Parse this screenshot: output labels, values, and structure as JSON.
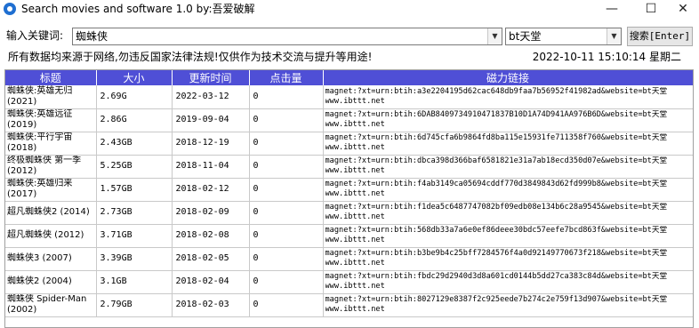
{
  "window": {
    "title": "Search movies and software 1.0 by:吾爱破解",
    "min_glyph": "—",
    "max_glyph": "☐",
    "close_glyph": "✕"
  },
  "search": {
    "label": "输入关键词:",
    "keyword": "蜘蛛侠",
    "site": "bt天堂",
    "button_label": "搜索[Enter]"
  },
  "notice": {
    "text": "所有数据均来源于网络,勿违反国家法律法规!仅供作为技术交流与提升等用途!",
    "datetime": "2022-10-11  15:10:14  星期二"
  },
  "table": {
    "headers": [
      "标题",
      "大小",
      "更新时间",
      "点击量",
      "磁力链接"
    ],
    "rows": [
      {
        "title": "蜘蛛侠:英雄无归\n(2021)",
        "size": "2.69G",
        "date": "2022-03-12",
        "clicks": "0",
        "magnet": "magnet:?xt=urn:btih:a3e2204195d62cac648db9faa7b56952f41982ad&website=bt天堂",
        "site": "www.ibttt.net"
      },
      {
        "title": "蜘蛛侠:英雄远征\n(2019)",
        "size": "2.86G",
        "date": "2019-09-04",
        "clicks": "0",
        "magnet": "magnet:?xt=urn:btih:6DAB8409734910471837B10D1A74D941AA976B6D&website=bt天堂",
        "site": "www.ibttt.net"
      },
      {
        "title": "蜘蛛侠:平行宇宙\n(2018)",
        "size": "2.43GB",
        "date": "2018-12-19",
        "clicks": "0",
        "magnet": "magnet:?xt=urn:btih:6d745cfa6b9864fd8ba115e15931fe711358f760&website=bt天堂",
        "site": "www.ibttt.net"
      },
      {
        "title": "终极蜘蛛侠 第一季\n(2012)",
        "size": "5.25GB",
        "date": "2018-11-04",
        "clicks": "0",
        "magnet": "magnet:?xt=urn:btih:dbca398d366baf6581821e31a7ab18ecd350d07e&website=bt天堂",
        "site": "www.ibttt.net"
      },
      {
        "title": "蜘蛛侠:英雄归来\n(2017)",
        "size": "1.57GB",
        "date": "2018-02-12",
        "clicks": "0",
        "magnet": "magnet:?xt=urn:btih:f4ab3149ca05694cddf770d3849843d62fd999b8&website=bt天堂",
        "site": "www.ibttt.net"
      },
      {
        "title": "超凡蜘蛛侠2 (2014)",
        "size": "2.73GB",
        "date": "2018-02-09",
        "clicks": "0",
        "magnet": "magnet:?xt=urn:btih:f1dea5c6487747082bf09edb08e134b6c28a9545&website=bt天堂",
        "site": "www.ibttt.net"
      },
      {
        "title": "超凡蜘蛛侠 (2012)",
        "size": "3.71GB",
        "date": "2018-02-08",
        "clicks": "0",
        "magnet": "magnet:?xt=urn:btih:568db33a7a6e0ef86deee30bdc57eefe7bcd863f&website=bt天堂",
        "site": "www.ibttt.net"
      },
      {
        "title": "蜘蛛侠3 (2007)",
        "size": "3.39GB",
        "date": "2018-02-05",
        "clicks": "0",
        "magnet": "magnet:?xt=urn:btih:b3be9b4c25bff7284576f4a0d92149770673f218&website=bt天堂",
        "site": "www.ibttt.net"
      },
      {
        "title": "蜘蛛侠2 (2004)",
        "size": "3.1GB",
        "date": "2018-02-04",
        "clicks": "0",
        "magnet": "magnet:?xt=urn:btih:fbdc29d2940d3d8a601cd0144b5dd27ca383c84d&website=bt天堂",
        "site": "www.ibttt.net"
      },
      {
        "title": "蜘蛛侠 Spider-Man\n(2002)",
        "size": "2.79GB",
        "date": "2018-02-03",
        "clicks": "0",
        "magnet": "magnet:?xt=urn:btih:8027129e8387f2c925eede7b274c2e759f13d907&website=bt天堂",
        "site": "www.ibttt.net"
      }
    ]
  },
  "colors": {
    "header_bg": "#4f4fd6",
    "header_text": "#ffffff",
    "app_icon": "#1f6fd1"
  }
}
